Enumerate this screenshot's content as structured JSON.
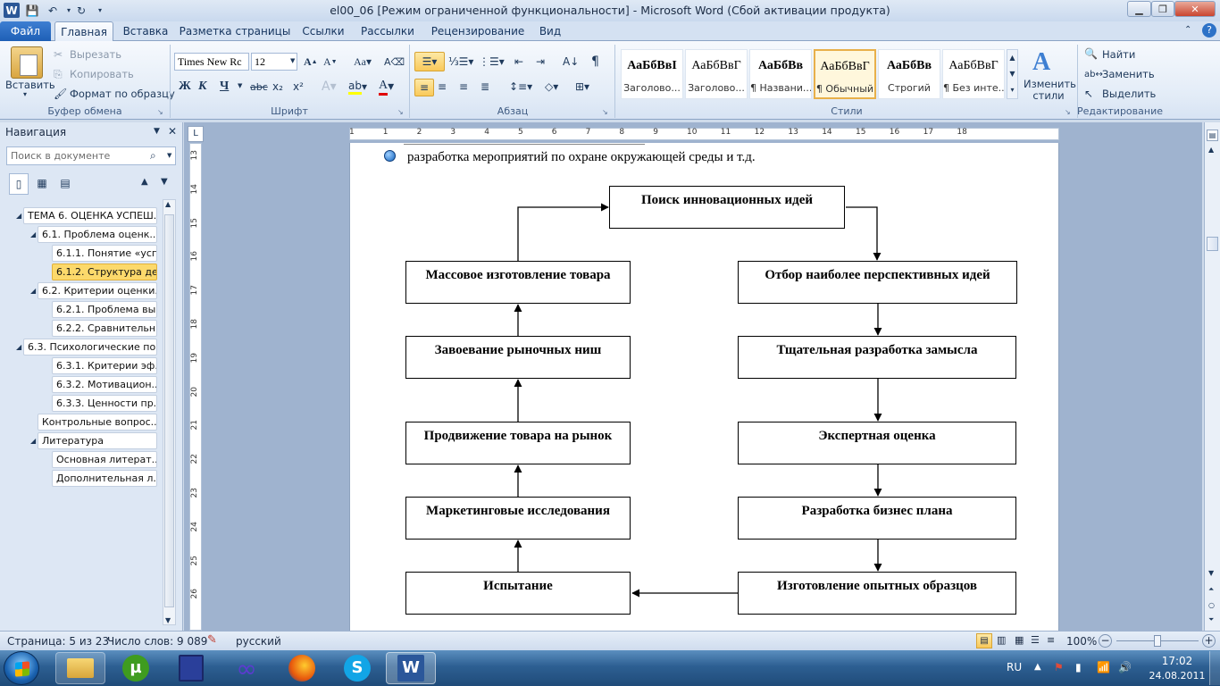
{
  "window": {
    "title": "el00_06 [Режим ограниченной функциональности]  -  Microsoft Word (Сбой активации продукта)"
  },
  "tabs": [
    "Файл",
    "Главная",
    "Вставка",
    "Разметка страницы",
    "Ссылки",
    "Рассылки",
    "Рецензирование",
    "Вид"
  ],
  "ribbon": {
    "clipboard": {
      "paste": "Вставить",
      "cut": "Вырезать",
      "copy": "Копировать",
      "format_painter": "Формат по образцу",
      "label": "Буфер обмена"
    },
    "font": {
      "name": "Times New Rc",
      "size": "12",
      "label": "Шрифт",
      "bold": "Ж",
      "italic": "К",
      "underline": "Ч",
      "strike": "abc",
      "sub": "x₂",
      "sup": "x²"
    },
    "paragraph": {
      "label": "Абзац"
    },
    "styles": {
      "label": "Стили",
      "items": [
        {
          "sample": "АаБбВвI",
          "name": "Заголово..."
        },
        {
          "sample": "АаБбВвГ",
          "name": "Заголово..."
        },
        {
          "sample": "АаБбВв",
          "name": "¶ Названи..."
        },
        {
          "sample": "АаБбВвГ",
          "name": "¶ Обычный"
        },
        {
          "sample": "АаБбВв",
          "name": "Строгий"
        },
        {
          "sample": "АаБбВвГ",
          "name": "¶ Без инте..."
        }
      ],
      "change": "Изменить стили"
    },
    "editing": {
      "find": "Найти",
      "replace": "Заменить",
      "select": "Выделить",
      "label": "Редактирование"
    }
  },
  "nav": {
    "title": "Навигация",
    "search_placeholder": "Поиск в документе",
    "items": [
      {
        "text": "ТЕМА 6. ОЦЕНКА УСПЕШ..."
      },
      {
        "text": "6.1. Проблема оценк..."
      },
      {
        "text": "6.1.1. Понятие «усп..."
      },
      {
        "text": "6.1.2. Структура де..."
      },
      {
        "text": "6.2. Критерии оценки..."
      },
      {
        "text": "6.2.1. Проблема вы..."
      },
      {
        "text": "6.2.2. Сравнительн..."
      },
      {
        "text": "6.3. Психологические по..."
      },
      {
        "text": "6.3.1. Критерии эф..."
      },
      {
        "text": "6.3.2. Мотивацион..."
      },
      {
        "text": "6.3.3. Ценности пр..."
      },
      {
        "text": "Контрольные вопрос..."
      },
      {
        "text": "Литература"
      },
      {
        "text": "Основная литерат..."
      },
      {
        "text": "Дополнительная л..."
      }
    ]
  },
  "ruler": {
    "numbers": [
      "1",
      "1",
      "2",
      "3",
      "4",
      "5",
      "6",
      "7",
      "8",
      "9",
      "10",
      "11",
      "12",
      "13",
      "14",
      "15",
      "16",
      "17",
      "18"
    ],
    "vnumbers": [
      "13",
      "14",
      "15",
      "16",
      "17",
      "18",
      "19",
      "20",
      "21",
      "22",
      "23",
      "24",
      "25",
      "26"
    ]
  },
  "document": {
    "bullet_text": "разработка мероприятий по охране окружающей среды и т.д.",
    "boxes": {
      "top": "Поиск инновационных идей",
      "r1": "Отбор наиболее перспективных идей",
      "r2": "Тщательная разработка замысла",
      "r3": "Экспертная оценка",
      "r4": "Разработка бизнес плана",
      "r5": "Изготовление опытных образцов",
      "l1": "Массовое изготовление товара",
      "l2": "Завоевание рыночных ниш",
      "l3": "Продвижение товара на рынок",
      "l4": "Маркетинговые исследования",
      "l5": "Испытание"
    }
  },
  "status": {
    "page": "Страница: 5 из 23",
    "words": "Число слов: 9 089",
    "lang": "русский",
    "zoom": "100%"
  },
  "taskbar": {
    "lang": "RU",
    "time": "17:02",
    "date": "24.08.2011"
  }
}
